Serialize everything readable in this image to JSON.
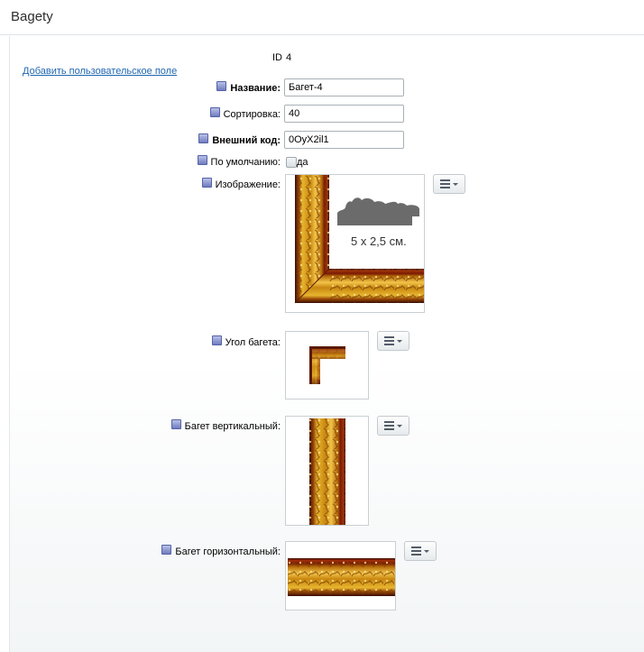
{
  "page": {
    "title": "Bagety"
  },
  "record": {
    "id_label": "ID",
    "id_value": "4"
  },
  "add_field_link": "Добавить пользовательское поле",
  "fields": {
    "name": {
      "label": "Название:",
      "value": "Багет-4"
    },
    "sort": {
      "label": "Сортировка:",
      "value": "40"
    },
    "ext_code": {
      "label": "Внешний код:",
      "value": "0OyX2il1"
    },
    "default": {
      "label": "По умолчанию:",
      "checkbox_label": "да",
      "checked": false
    },
    "image": {
      "label": "Изображение:",
      "caption": "5 x 2,5 см."
    },
    "corner": {
      "label": "Угол багета:"
    },
    "vertical": {
      "label": "Багет вертикальный:"
    },
    "horizontal": {
      "label": "Багет горизонтальный:"
    }
  },
  "icons": {
    "field_marker": "required-field-square-icon",
    "menu": "hamburger-menu-icon",
    "dropdown": "chevron-down-icon"
  },
  "colors": {
    "link": "#2067b0",
    "frame_gold": "#d9a21c",
    "frame_dark": "#5a0e02"
  }
}
